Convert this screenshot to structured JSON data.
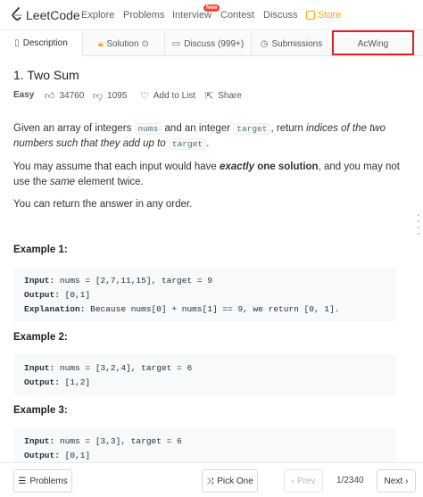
{
  "nav": {
    "logo_text": "LeetCode",
    "items": [
      "Explore",
      "Problems",
      "Interview",
      "Contest",
      "Discuss"
    ],
    "badge": "New",
    "store": "Store"
  },
  "tabs": [
    {
      "label": "Description",
      "icon": "document-icon"
    },
    {
      "label": "Solution",
      "icon": "lock-icon"
    },
    {
      "label": "Discuss (999+)",
      "icon": "chat-icon"
    },
    {
      "label": "Submissions",
      "icon": "clock-icon"
    },
    {
      "label": "AcWing"
    }
  ],
  "problem": {
    "title": "1. Two Sum",
    "difficulty": "Easy",
    "likes": "34760",
    "dislikes": "1095",
    "add_to_list": "Add to List",
    "share": "Share"
  },
  "description": {
    "p1_a": "Given an array of integers ",
    "p1_code1": "nums",
    "p1_b": " and an integer ",
    "p1_code2": "target",
    "p1_c": ", return ",
    "p1_em": "indices of the two numbers such that they add up to",
    "p1_code3": "target",
    "p1_d": ".",
    "p2_a": "You may assume that each input would have ",
    "p2_strong1": "exactly",
    "p2_strong2": " one solution",
    "p2_b": ", and you may not use the ",
    "p2_em": "same",
    "p2_c": " element twice.",
    "p3": "You can return the answer in any order."
  },
  "examples": [
    {
      "title": "Example 1:",
      "lines": [
        {
          "label": "Input:",
          "text": " nums = [2,7,11,15], target = 9"
        },
        {
          "label": "Output:",
          "text": " [0,1]"
        },
        {
          "label": "Explanation:",
          "text": " Because nums[0] + nums[1] == 9, we return [0, 1]."
        }
      ]
    },
    {
      "title": "Example 2:",
      "lines": [
        {
          "label": "Input:",
          "text": " nums = [3,2,4], target = 6"
        },
        {
          "label": "Output:",
          "text": " [1,2]"
        }
      ]
    },
    {
      "title": "Example 3:",
      "lines": [
        {
          "label": "Input:",
          "text": " nums = [3,3], target = 6"
        },
        {
          "label": "Output:",
          "text": " [0,1]"
        }
      ]
    }
  ],
  "bottom": {
    "problems": "Problems",
    "pick_one": "Pick One",
    "prev": "Prev",
    "page": "1/2340",
    "next": "Next"
  },
  "colors": {
    "accent": "#ffa116",
    "easy": "#43a047",
    "highlight_box": "#e0202a"
  }
}
